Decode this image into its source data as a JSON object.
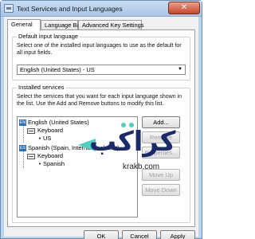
{
  "window": {
    "title": "Text Services and Input Languages",
    "close_glyph": "✕",
    "app_icon": "keyboard-app-icon"
  },
  "tabs": [
    {
      "label": "General",
      "active": true
    },
    {
      "label": "Language Bar",
      "active": false
    },
    {
      "label": "Advanced Key Settings",
      "active": false
    }
  ],
  "default_input": {
    "label": "Default input language",
    "description": "Select one of the installed input languages to use as the default for all input fields.",
    "selected": "English (United States) - US",
    "arrow_glyph": "▼"
  },
  "installed": {
    "label": "Installed services",
    "description": "Select the services that you want for each input language shown in the list. Use the Add and Remove buttons to modify this list.",
    "tree": [
      {
        "badge": "EN",
        "language": "English (United States)",
        "category": "Keyboard",
        "layout": "US"
      },
      {
        "badge": "ES",
        "language": "Spanish (Spain, International Sort)",
        "category": "Keyboard",
        "layout": "Spanish"
      }
    ],
    "bullet_glyph": "•",
    "buttons": {
      "add": "Add...",
      "remove": "Remove",
      "properties": "Properties...",
      "move_up": "Move Up",
      "move_down": "Move Down"
    }
  },
  "footer": {
    "ok": "OK",
    "cancel": "Cancel",
    "apply": "Apply"
  },
  "watermark": {
    "logo_text": "كراكب",
    "url": "krakb.com",
    "accent_color": "#4fd0c3",
    "text_color": "#1b2a6b"
  }
}
